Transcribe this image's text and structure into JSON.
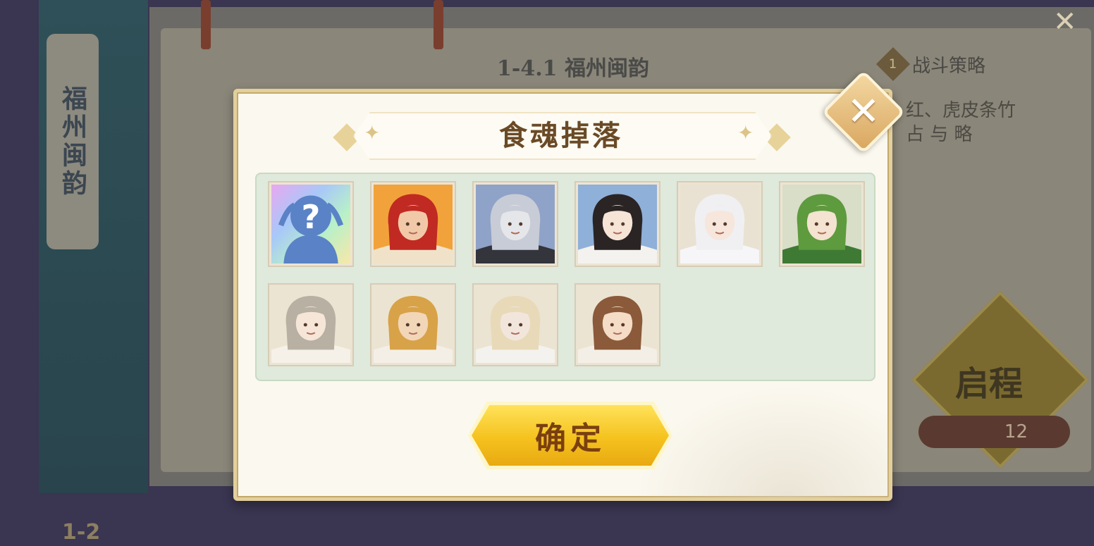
{
  "background": {
    "banner_text": "福州闽韵",
    "stage_title": "1-4.1 福州闽韵",
    "tag_number": "1",
    "tag_label": "战斗策略",
    "desc_line1": "红、虎皮条竹",
    "desc_line2": "占 与 略",
    "start_label": "启程",
    "cost_value": "12",
    "stage_code": "1-2"
  },
  "modal": {
    "title": "食魂掉落",
    "confirm_label": "确定",
    "close_icon": "close-icon"
  },
  "drops": [
    {
      "name": "unknown-soul",
      "unknown": true,
      "question": "?"
    },
    {
      "name": "red-hair-soul",
      "bg": "#f2a23a",
      "hair": "#c02a22",
      "skin": "#f2c9a8",
      "cloth": "#f0e2c8"
    },
    {
      "name": "silver-hat-soul",
      "bg": "#8fa2c8",
      "hair": "#c8ccd6",
      "skin": "#e4e6ea",
      "cloth": "#33343c"
    },
    {
      "name": "black-hair-soul",
      "bg": "#8fb0d8",
      "hair": "#2a2424",
      "skin": "#f6e4d6",
      "cloth": "#f4f2ee"
    },
    {
      "name": "white-hair-soul",
      "bg": "#e9e1d2",
      "hair": "#f0f0f2",
      "skin": "#f6e6dc",
      "cloth": "#f6f6f8"
    },
    {
      "name": "green-umbrella-soul",
      "bg": "#d8dec8",
      "hair": "#5e9a3e",
      "skin": "#f3e3d0",
      "cloth": "#3f7a34"
    },
    {
      "name": "flower-girl-soul",
      "bg": "#ece4d2",
      "hair": "#b8b0a2",
      "skin": "#f6e6d8",
      "cloth": "#f6f1e8"
    },
    {
      "name": "blond-warrior-soul",
      "bg": "#ece4d2",
      "hair": "#d8a248",
      "skin": "#f2d6b8",
      "cloth": "#f4efe6"
    },
    {
      "name": "straw-hat-soul",
      "bg": "#ece4d2",
      "hair": "#e8d9b8",
      "skin": "#f2e6dc",
      "cloth": "#f4f2ee"
    },
    {
      "name": "brown-hair-soul",
      "bg": "#ece4d2",
      "hair": "#8a5a3a",
      "skin": "#f4dcc6",
      "cloth": "#f4efe6"
    }
  ],
  "colors": {
    "modal_bg": "#fbf8ef",
    "modal_border": "#e3cf9c",
    "drop_area": "#dfe9dc",
    "title_text": "#6a4a26",
    "button_gold": "#f5c21e",
    "button_text": "#7a3f10"
  }
}
